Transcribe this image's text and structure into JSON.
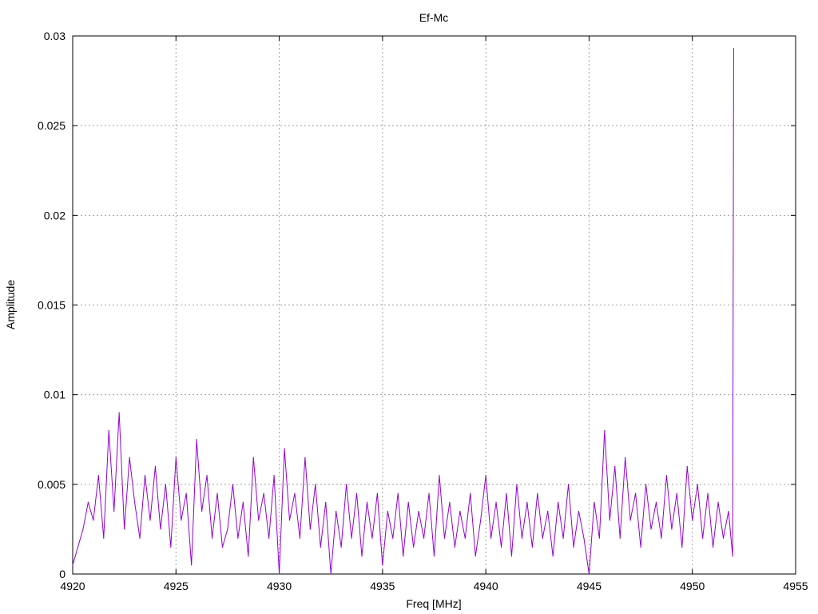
{
  "chart_data": {
    "type": "line",
    "title": "Ef-Mc",
    "xlabel": "Freq [MHz]",
    "ylabel": "Amplitude",
    "xlim": [
      4920,
      4955
    ],
    "ylim": [
      0,
      0.03
    ],
    "xticks": [
      4920,
      4925,
      4930,
      4935,
      4940,
      4945,
      4950,
      4955
    ],
    "xtick_labels": [
      "4920",
      "4925",
      "4930",
      "4935",
      "4940",
      "4945",
      "4950",
      "4955"
    ],
    "yticks": [
      0,
      0.005,
      0.01,
      0.015,
      0.02,
      0.025,
      0.03
    ],
    "ytick_labels": [
      "0",
      "0.005",
      "0.01",
      "0.015",
      "0.02",
      "0.025",
      "0.03"
    ],
    "grid": true,
    "series_color": "#9400d3",
    "series": [
      {
        "x": [
          4920.0,
          4920.25,
          4920.5,
          4920.75,
          4921.0,
          4921.25,
          4921.5,
          4921.75,
          4922.0,
          4922.25,
          4922.5,
          4922.75,
          4923.0,
          4923.25,
          4923.5,
          4923.75,
          4924.0,
          4924.25,
          4924.5,
          4924.75,
          4925.0,
          4925.25,
          4925.5,
          4925.75,
          4926.0,
          4926.25,
          4926.5,
          4926.75,
          4927.0,
          4927.25,
          4927.5,
          4927.75,
          4928.0,
          4928.25,
          4928.5,
          4928.75,
          4929.0,
          4929.25,
          4929.5,
          4929.75,
          4930.0,
          4930.25,
          4930.5,
          4930.75,
          4931.0,
          4931.25,
          4931.5,
          4931.75,
          4932.0,
          4932.25,
          4932.5,
          4932.75,
          4933.0,
          4933.25,
          4933.5,
          4933.75,
          4934.0,
          4934.25,
          4934.5,
          4934.75,
          4935.0,
          4935.25,
          4935.5,
          4935.75,
          4936.0,
          4936.25,
          4936.5,
          4936.75,
          4937.0,
          4937.25,
          4937.5,
          4937.75,
          4938.0,
          4938.25,
          4938.5,
          4938.75,
          4939.0,
          4939.25,
          4939.5,
          4939.75,
          4940.0,
          4940.25,
          4940.5,
          4940.75,
          4941.0,
          4941.25,
          4941.5,
          4941.75,
          4942.0,
          4942.25,
          4942.5,
          4942.75,
          4943.0,
          4943.25,
          4943.5,
          4943.75,
          4944.0,
          4944.25,
          4944.5,
          4944.75,
          4945.0,
          4945.25,
          4945.5,
          4945.75,
          4946.0,
          4946.25,
          4946.5,
          4946.75,
          4947.0,
          4947.25,
          4947.5,
          4947.75,
          4948.0,
          4948.25,
          4948.5,
          4948.75,
          4949.0,
          4949.25,
          4949.5,
          4949.75,
          4950.0,
          4950.25,
          4950.5,
          4950.75,
          4951.0,
          4951.25,
          4951.5,
          4951.75,
          4951.95,
          4952.0
        ],
        "y": [
          0.0005,
          0.0015,
          0.0025,
          0.004,
          0.003,
          0.0055,
          0.002,
          0.008,
          0.0035,
          0.009,
          0.0025,
          0.0065,
          0.004,
          0.002,
          0.0055,
          0.003,
          0.006,
          0.0025,
          0.005,
          0.0015,
          0.0065,
          0.003,
          0.0045,
          0.0005,
          0.0075,
          0.0035,
          0.0055,
          0.002,
          0.0045,
          0.0015,
          0.0025,
          0.005,
          0.002,
          0.004,
          0.001,
          0.0065,
          0.003,
          0.0045,
          0.002,
          0.0055,
          0.0,
          0.007,
          0.003,
          0.0045,
          0.002,
          0.0065,
          0.0025,
          0.005,
          0.0015,
          0.004,
          0.0,
          0.0035,
          0.0015,
          0.005,
          0.002,
          0.0045,
          0.001,
          0.004,
          0.002,
          0.0045,
          0.0005,
          0.0035,
          0.002,
          0.0045,
          0.001,
          0.004,
          0.0015,
          0.0035,
          0.002,
          0.0045,
          0.001,
          0.0055,
          0.002,
          0.004,
          0.0015,
          0.0035,
          0.002,
          0.0045,
          0.001,
          0.003,
          0.0055,
          0.002,
          0.004,
          0.0015,
          0.0045,
          0.001,
          0.005,
          0.002,
          0.004,
          0.0015,
          0.0045,
          0.002,
          0.0035,
          0.001,
          0.004,
          0.002,
          0.005,
          0.0015,
          0.0035,
          0.002,
          0.0,
          0.004,
          0.002,
          0.008,
          0.003,
          0.006,
          0.002,
          0.0065,
          0.003,
          0.0045,
          0.0015,
          0.005,
          0.0025,
          0.004,
          0.002,
          0.0055,
          0.0025,
          0.0045,
          0.0015,
          0.006,
          0.003,
          0.005,
          0.002,
          0.0045,
          0.0015,
          0.004,
          0.002,
          0.0035,
          0.001,
          0.0293
        ]
      }
    ]
  }
}
